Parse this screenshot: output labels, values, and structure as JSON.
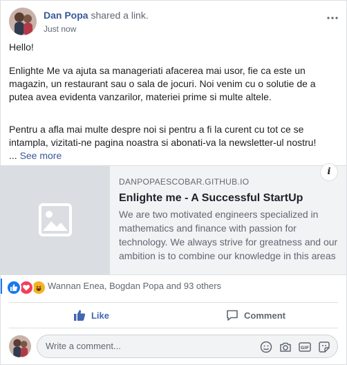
{
  "post": {
    "author": "Dan Popa",
    "action": " shared a link.",
    "time": "Just now",
    "more_icon": "more-horizontal-icon",
    "greeting": "Hello!",
    "paragraph1": "Enlighte Me va ajuta sa manageriati afacerea mai usor, fie ca este un magazin, un restaurant sau o sala de jocuri. Noi venim cu o solutie de a putea avea evidenta vanzarilor, materiei prime si multe altele.",
    "paragraph2": "Pentru a afla mai multe despre noi si pentru a fi la curent cu tot ce se intampla, vizitati-ne pagina noastra si abonati-va la newsletter-ul nostru!",
    "ellipsis": "... ",
    "see_more": "See more"
  },
  "link_preview": {
    "domain": "DANPOPAESCOBAR.GITHUB.IO",
    "title": "Enlighte me - A Successful StartUp",
    "description": "We are two motivated engineers specialized in mathematics and finance with passion for technology. We always strive for greatness and our ambition is to combine our knowledge in this areas",
    "info_label": "i",
    "image_icon": "image-placeholder-icon"
  },
  "reactions": {
    "icons": [
      "like-reaction-icon",
      "love-reaction-icon",
      "haha-reaction-icon"
    ],
    "summary": "Wannan Enea, Bogdan Popa and 93 others"
  },
  "actions": {
    "like": "Like",
    "comment": "Comment"
  },
  "composer": {
    "placeholder": "Write a comment...",
    "icons": [
      "emoji-icon",
      "camera-icon",
      "gif-icon",
      "sticker-icon"
    ]
  },
  "colors": {
    "link_blue": "#385898",
    "like_blue": "#4267b2",
    "secondary_text": "#606770",
    "preview_bg": "#f2f3f5"
  }
}
